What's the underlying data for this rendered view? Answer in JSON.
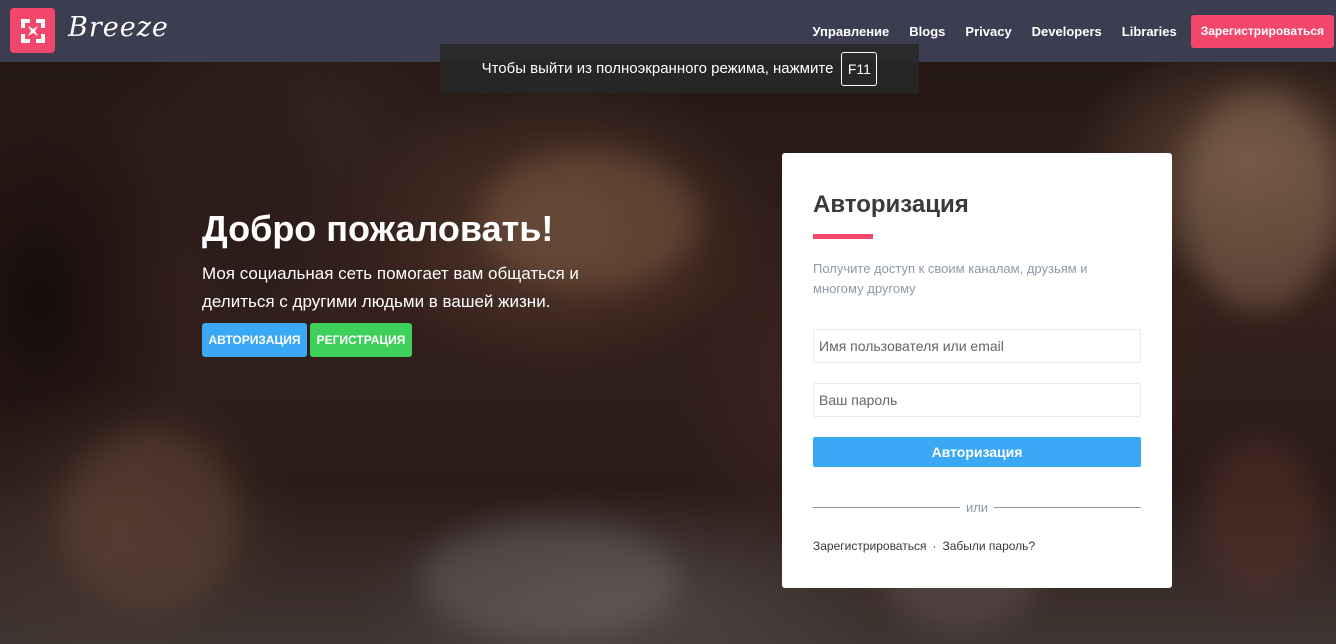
{
  "header": {
    "brand": "Breeze",
    "nav": [
      "Управление",
      "Blogs",
      "Privacy",
      "Developers",
      "Libraries"
    ],
    "cta": "Зарегистрироваться"
  },
  "toast": {
    "text": "Чтобы выйти из полноэкранного режима, нажмите",
    "key": "F11"
  },
  "hero": {
    "title": "Добро пожаловать!",
    "text": "Моя социальная сеть помогает вам общаться и делиться с другими людьми в вашей жизни.",
    "login_button": "АВТОРИЗАЦИЯ",
    "signup_button": "РЕГИСТРАЦИЯ"
  },
  "login_card": {
    "title": "Авторизация",
    "description": "Получите доступ к своим каналам, друзьям и многому другому",
    "username_placeholder": "Имя пользователя или email",
    "password_placeholder": "Ваш пароль",
    "submit": "Авторизация",
    "divider": "или",
    "register_link": "Зарегистрироваться",
    "separator": "·",
    "forgot_link": "Забыли пароль?"
  },
  "colors": {
    "header_bg": "#3d3d52",
    "accent_pink": "#f2476a",
    "primary_blue": "#3aa8f5",
    "success_green": "#3fd05c"
  },
  "icons": {
    "logo": "breeze-logo-icon"
  }
}
